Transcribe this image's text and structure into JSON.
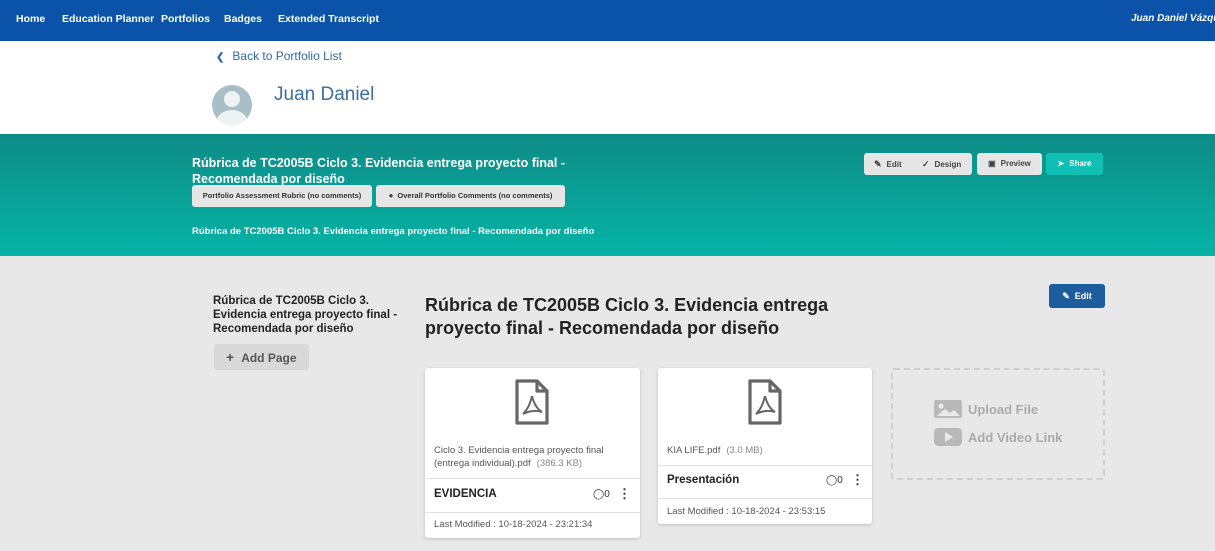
{
  "nav": {
    "items": [
      "Home",
      "Education Planner",
      "Portfolios",
      "Badges",
      "Extended Transcript"
    ],
    "user": "Juan Daniel Vázqu"
  },
  "header": {
    "back_label": "Back to Portfolio List",
    "user_name": "Juan Daniel"
  },
  "banner": {
    "title": "Rúbrica de TC2005B Ciclo 3. Evidencia entrega proyecto final - Recomendada por diseño",
    "chips": [
      "Portfolio Assessment Rubric (no comments)",
      "Overall Portfolio Comments (no comments)"
    ],
    "subtitle": "Rúbrica de TC2005B Ciclo 3. Evidencia entrega proyecto final - Recomendada por diseño",
    "buttons": {
      "edit": "Edit",
      "design": "Design",
      "preview": "Preview",
      "share": "Share"
    },
    "accent_color": "#0aa89d"
  },
  "sidebar": {
    "page_title": "Rúbrica de TC2005B Ciclo 3. Evidencia entrega proyecto final - Recomendada por diseño",
    "add_page_label": "Add Page"
  },
  "main": {
    "title": "Rúbrica de TC2005B Ciclo 3. Evidencia entrega proyecto final - Recomendada por diseño",
    "edit_label": "Edit",
    "cards": [
      {
        "filename": "Ciclo 3. Evidencia entrega proyecto final (entrega individual).pdf",
        "size": "(386.3 KB)",
        "name": "EVIDENCIA",
        "comments": "0",
        "modified": "Last Modified : 10-18-2024 - 23:21:34",
        "icon": "pdf-document-icon"
      },
      {
        "filename": "KIA LIFE.pdf",
        "size": "(3.0 MB)",
        "name": "Presentación",
        "comments": "0",
        "modified": "Last Modified : 10-18-2024 - 23:53:15",
        "icon": "pdf-document-icon"
      }
    ],
    "upload": {
      "upload_label": "Upload File",
      "video_label": "Add Video Link"
    }
  }
}
